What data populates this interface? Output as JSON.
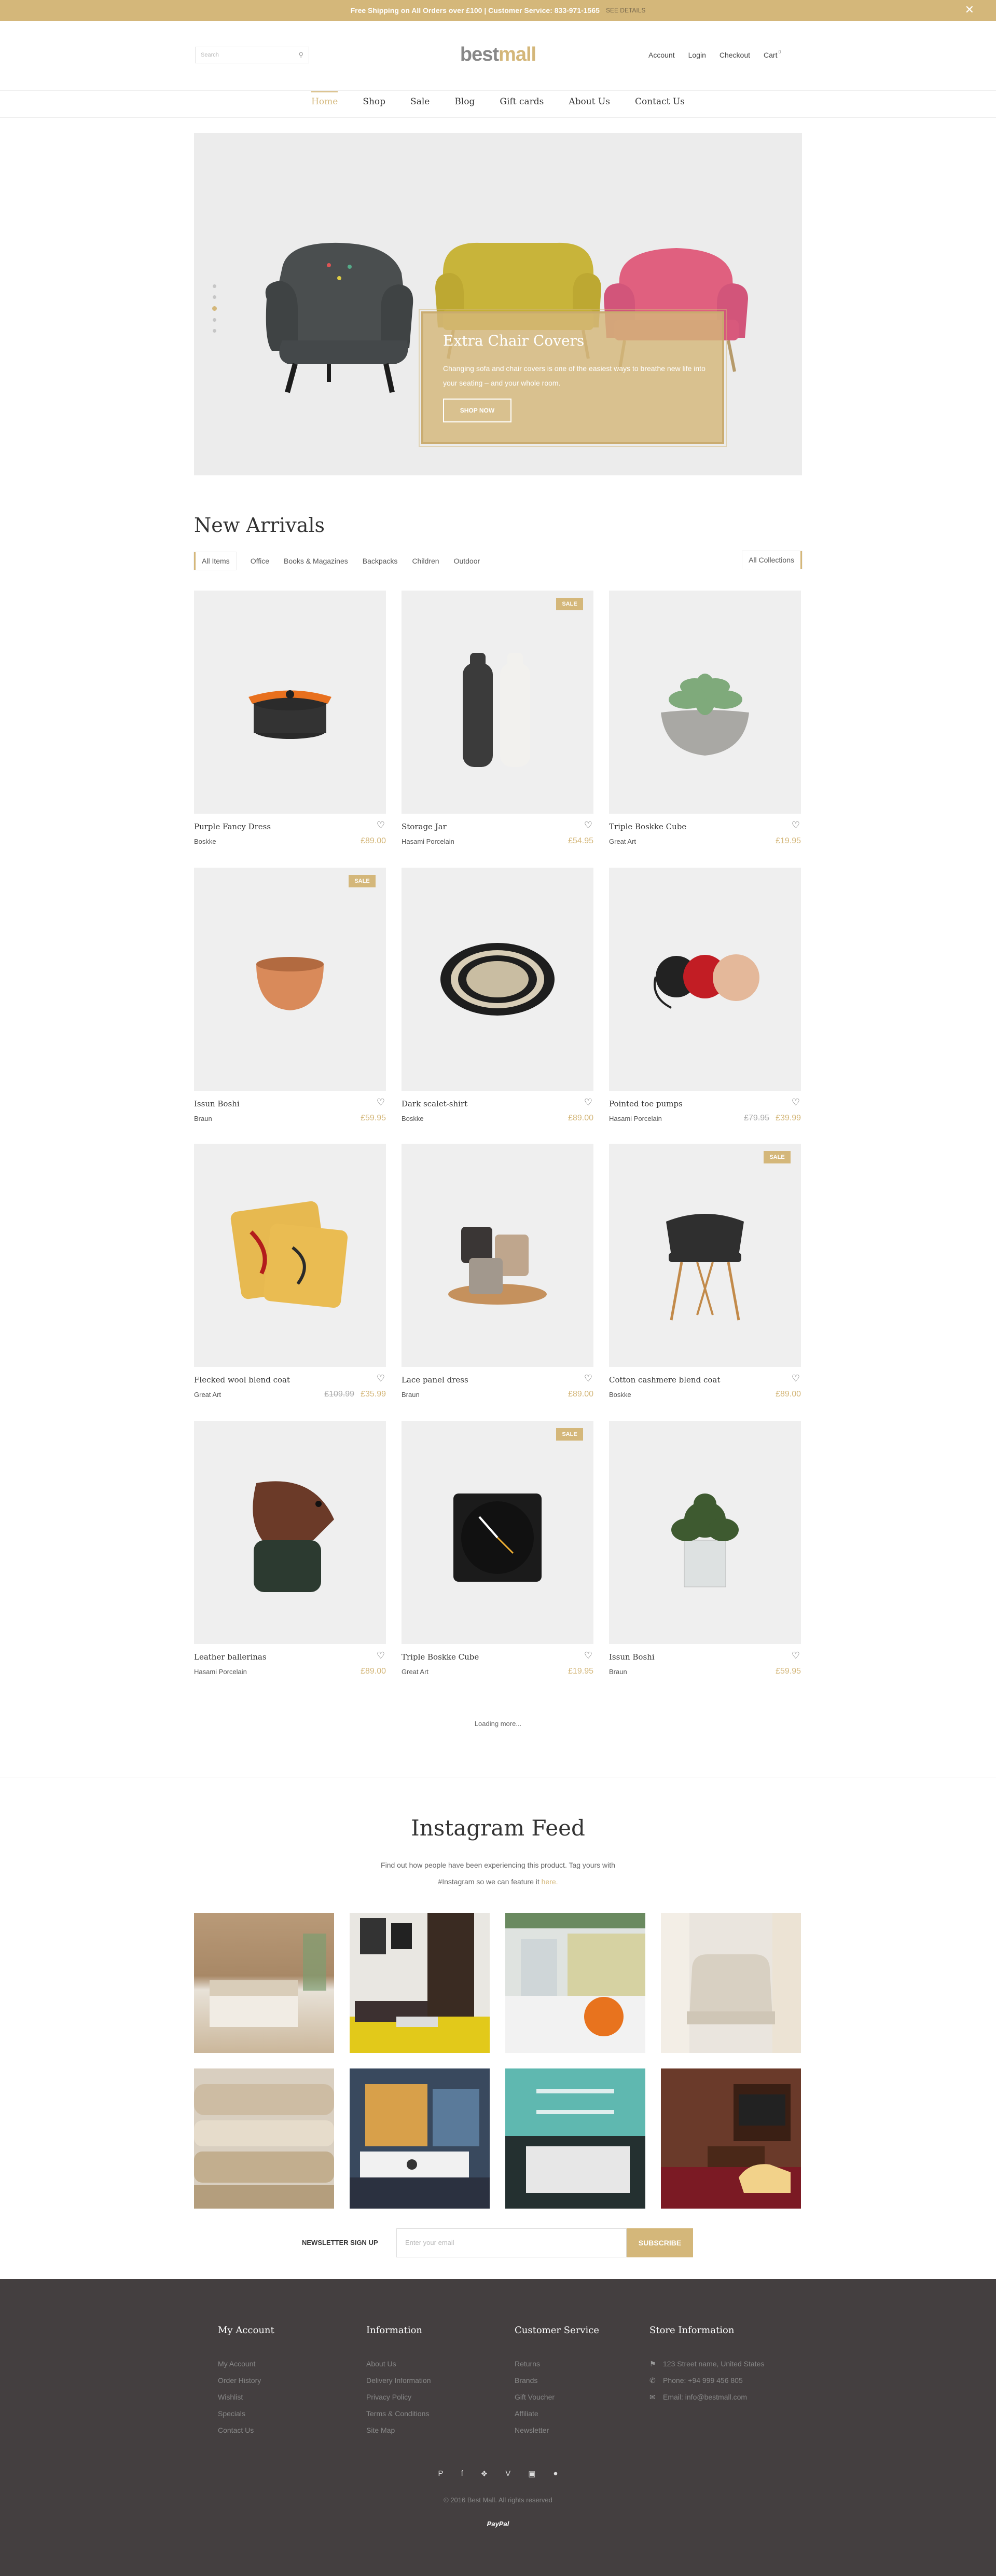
{
  "topbar": {
    "message": "Free Shipping on All Orders over £100 | Customer Service: 833-971-1565",
    "details": "SEE DETAILS",
    "close": "✕"
  },
  "header": {
    "search_placeholder": "Search",
    "logo_best": "best",
    "logo_mall": "mall",
    "links": [
      "Account",
      "Login",
      "Checkout",
      "Cart"
    ],
    "cart_count": "0"
  },
  "nav": [
    "Home",
    "Shop",
    "Sale",
    "Blog",
    "Gift cards",
    "About Us",
    "Contact Us"
  ],
  "hero": {
    "title": "Extra Chair Covers",
    "text": "Changing sofa and chair covers is one of the easiest ways to breathe new life into your seating – and your whole room.",
    "button": "SHOP NOW"
  },
  "new_arrivals": {
    "title": "New Arrivals",
    "filters": [
      "All Items",
      "Office",
      "Books & Magazines",
      "Backpacks",
      "Children",
      "Outdoor"
    ],
    "all_collections": "All Collections",
    "sale_label": "SALE",
    "products": [
      {
        "name": "Purple Fancy Dress",
        "brand": "Boskke",
        "price": "£89.00",
        "old_price": "",
        "sale": false
      },
      {
        "name": "Storage Jar",
        "brand": "Hasami Porcelain",
        "price": "£54.95",
        "old_price": "",
        "sale": true
      },
      {
        "name": "Triple Boskke Cube",
        "brand": "Great Art",
        "price": "£19.95",
        "old_price": "",
        "sale": false
      },
      {
        "name": "Issun Boshi",
        "brand": "Braun",
        "price": "£59.95",
        "old_price": "",
        "sale": true
      },
      {
        "name": "Dark scalet-shirt",
        "brand": "Boskke",
        "price": "£89.00",
        "old_price": "",
        "sale": false
      },
      {
        "name": "Pointed toe pumps",
        "brand": "Hasami Porcelain",
        "price": "£39.99",
        "old_price": "£79.95",
        "sale": false
      },
      {
        "name": "Flecked wool blend coat",
        "brand": "Great Art",
        "price": "£35.99",
        "old_price": "£109.99",
        "sale": false
      },
      {
        "name": "Lace panel dress",
        "brand": "Braun",
        "price": "£89.00",
        "old_price": "",
        "sale": false
      },
      {
        "name": "Cotton cashmere blend coat",
        "brand": "Boskke",
        "price": "£89.00",
        "old_price": "",
        "sale": true
      },
      {
        "name": "Leather ballerinas",
        "brand": "Hasami Porcelain",
        "price": "£89.00",
        "old_price": "",
        "sale": false
      },
      {
        "name": "Triple Boskke Cube",
        "brand": "Great Art",
        "price": "£19.95",
        "old_price": "",
        "sale": true
      },
      {
        "name": "Issun Boshi",
        "brand": "Braun",
        "price": "£59.95",
        "old_price": "",
        "sale": false
      }
    ],
    "loading": "Loading more..."
  },
  "instagram": {
    "title": "Instagram Feed",
    "text": "Find out how people have been experiencing this product. Tag yours with #Instagram so we can feature it",
    "here": "here."
  },
  "newsletter": {
    "label": "NEWSLETTER SIGN UP",
    "placeholder": "Enter your email",
    "button": "SUBSCRIBE"
  },
  "footer": {
    "columns": [
      {
        "title": "My Account",
        "items": [
          "My Account",
          "Order History",
          "Wishlist",
          "Specials",
          "Contact Us"
        ]
      },
      {
        "title": "Information",
        "items": [
          "About Us",
          "Delivery Information",
          "Privacy Policy",
          "Terms & Conditions",
          "Site Map"
        ]
      },
      {
        "title": "Customer Service",
        "items": [
          "Returns",
          "Brands",
          "Gift Voucher",
          "Affiliate",
          "Newsletter"
        ]
      },
      {
        "title": "Store Information",
        "items": [
          "123 Street name, United States",
          "Phone: +94 999 456 805",
          "Email: info@bestmall.com"
        ]
      }
    ],
    "social_icons": [
      "pinterest-icon",
      "facebook-icon",
      "twitter-icon",
      "vimeo-icon",
      "instagram-icon",
      "reddit-icon"
    ],
    "copyright": "© 2016 Best Mall. All rights reserved",
    "payment": "PayPal"
  },
  "colors": {
    "accent": "#d4b77a",
    "footer_bg": "#443f40",
    "tile_bg": "#efefef"
  }
}
